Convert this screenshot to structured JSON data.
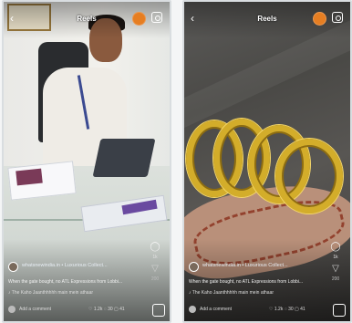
{
  "panels": [
    {
      "title": "Reels",
      "back_glyph": "‹",
      "author": "whatsnewindia.in • Luxurious Collect...",
      "caption": "When the gate bought, no ATL Expressions from Lobbi...",
      "music": "♪ The Kaho Jaanthhhhh main mein athaar",
      "comment_placeholder": "Add a comment",
      "stat": "♡ 1.2k  ◌ 30  ▢ 41",
      "side_counts": [
        "1k",
        "200"
      ],
      "colors": {
        "accent": "#e67e22"
      }
    },
    {
      "title": "Reels",
      "back_glyph": "‹",
      "author": "whatsnewindia.in • Luxurious Collect...",
      "caption": "When the gate bought, no ATL Expressions from Lobbi...",
      "music": "♪ The Kaho Jaanthhhhh main mein athaar",
      "comment_placeholder": "Add a comment",
      "stat": "♡ 1.2k  ◌ 30  ▢ 41",
      "side_counts": [
        "1k",
        "200"
      ],
      "colors": {
        "accent": "#e67e22"
      }
    }
  ],
  "icons": {
    "left_comment": "comment-icon",
    "left_share": "share-icon",
    "corner": "external-share-icon",
    "profile": "profile-icon",
    "camera": "camera-icon"
  }
}
